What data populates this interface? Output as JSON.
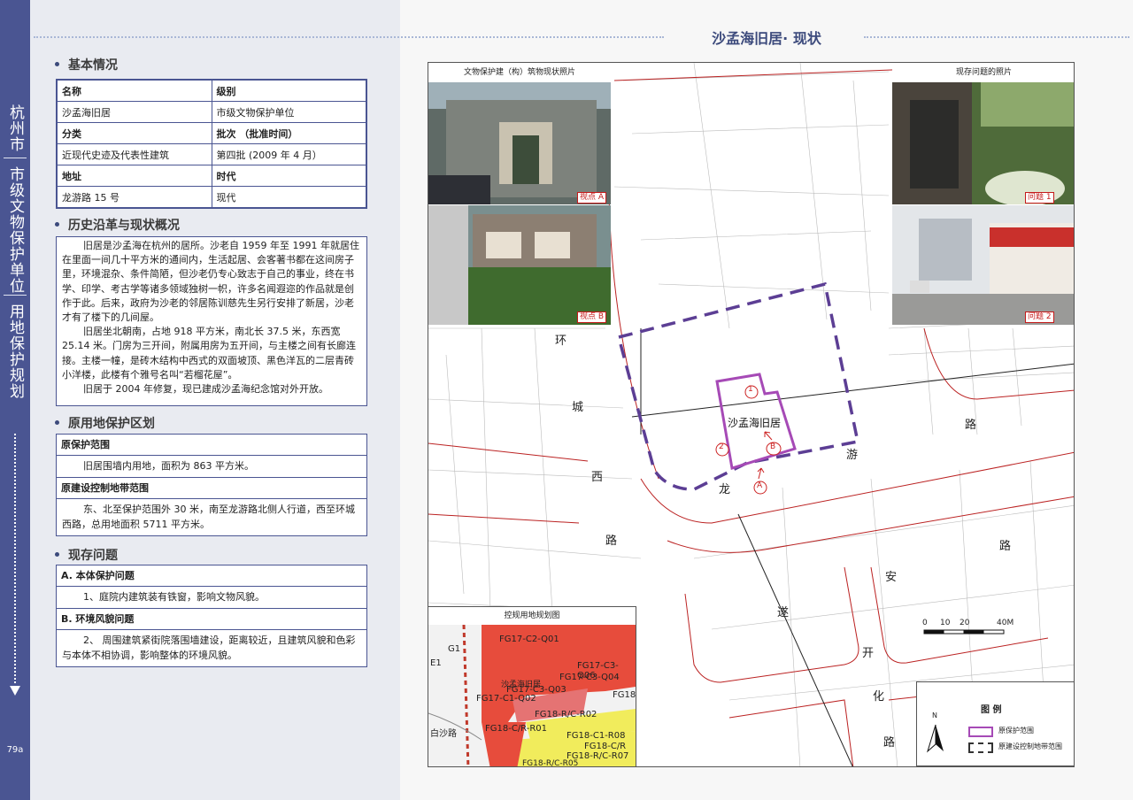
{
  "sidebar": {
    "city": "杭州市",
    "category": "市级文物保护单位",
    "section": "用地保护规划",
    "page": "79a"
  },
  "basic": {
    "title": "基本情况",
    "name_label": "名称",
    "level_label": "级别",
    "name": "沙孟海旧居",
    "level": "市级文物保护单位",
    "type_label": "分类",
    "batch_label": "批次 （批准时间）",
    "type": "近现代史迹及代表性建筑",
    "batch": "第四批 (2009 年 4 月）",
    "addr_label": "地址",
    "era_label": "时代",
    "addr": "龙游路 15 号",
    "era": "现代"
  },
  "history": {
    "title": "历史沿革与现状概况",
    "p1": "旧居是沙孟海在杭州的居所。沙老自 1959 年至 1991 年就居住在里面一间几十平方米的通间内，生活起居、会客著书都在这间房子里，环境混杂、条件简陋，但沙老仍专心致志于自己的事业，终在书学、印学、考古学等诸多领域独树一帜，许多名闻遐迩的作品就是创作于此。后来，政府为沙老的邻居陈训慈先生另行安排了新居，沙老才有了楼下的几间屋。",
    "p2": "旧居坐北朝南，占地 918 平方米，南北长 37.5 米，东西宽 25.14 米。门房为三开间，附属用房为五开间，与主楼之间有长廊连接。主楼一幢，是砖木结构中西式的双面坡顶、黑色洋瓦的二层青砖小洋楼，此楼有个雅号名叫“若榴花屋”。",
    "p3": "旧居于 2004 年修复，现已建成沙孟海纪念馆对外开放。"
  },
  "zoning": {
    "title": "原用地保护区划",
    "range_label": "原保护范围",
    "range_text": "旧居围墙内用地，面积为 863 平方米。",
    "control_label": "原建设控制地带范围",
    "control_text": "东、北至保护范围外 30 米，南至龙游路北侧人行道，西至环城西路，总用地面积 5711 平方米。"
  },
  "issues": {
    "title": "现存问题",
    "a_label": "A. 本体保护问题",
    "a_text": "1、庭院内建筑装有铁窗，影响文物风貌。",
    "b_label": "B. 环境风貌问题",
    "b_text": "2、 周围建筑紧街院落围墙建设，距离较近，且建筑风貌和色彩与本体不相协调，影响整体的环境风貌。"
  },
  "map": {
    "title": "沙孟海旧居· 现状",
    "photos_left_caption": "文物保护建（构）筑物现状照片",
    "photos_right_caption": "现存问题的照片",
    "view_a": "视点 A",
    "view_b": "视点 B",
    "issue_1": "问题 1",
    "issue_2": "问题 2",
    "site_label": "沙孟海旧居",
    "road_huan": "环",
    "road_cheng": "城",
    "road_xi": "西",
    "road_lu": "路",
    "road_long": "龙",
    "road_you": "游",
    "road_lu2": "路",
    "road_an": "安",
    "road_sui": "遂",
    "road_lu3": "路",
    "road_kai": "开",
    "road_hua": "化",
    "road_lu4": "路",
    "marker_1": "1",
    "marker_2": "2",
    "marker_a": "A",
    "marker_b": "B",
    "scale_ticks": [
      "0",
      "10",
      "20",
      "40M"
    ],
    "inset_caption": "控规用地规划图",
    "inset_labels": [
      "FG17-C2-Q01",
      "FG17-C3-Q06",
      "FG17-C3-Q04",
      "沙孟海旧居",
      "FG17-C3-Q03",
      "FG17-C1-Q02",
      "FG18",
      "FG18-R/C-R02",
      "FG18-C/R-R01",
      "FG18-C1-R08",
      "FG18-C/R",
      "FG18-R/C-R07",
      "FG18-R/C-R05",
      "白沙路",
      "G1",
      "E1"
    ],
    "legend_title": "图 例",
    "legend_north": "N",
    "legend_range": "原保护范围",
    "legend_control": "原建设控制地带范围"
  }
}
